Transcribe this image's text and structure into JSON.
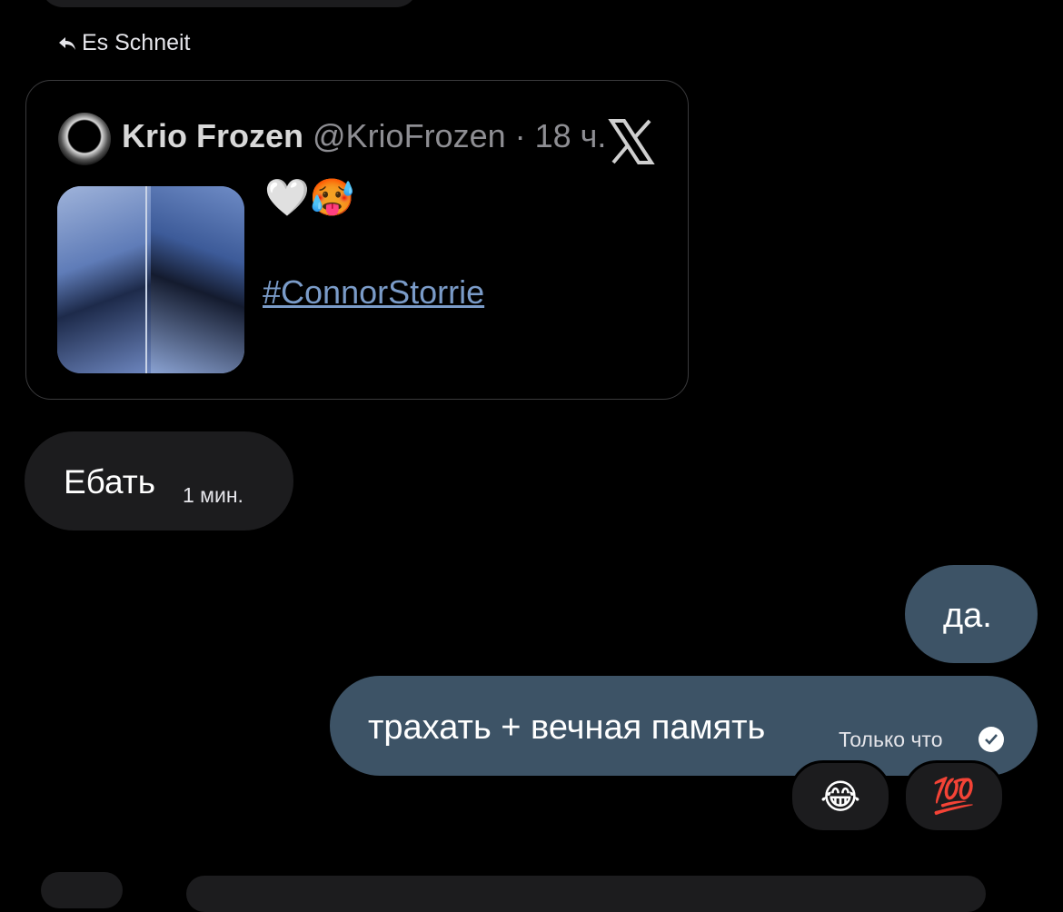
{
  "reply": {
    "label": "Es Schneit"
  },
  "tweet": {
    "name": "Krio Frozen",
    "handle_time": "@KrioFrozen · 18 ч.",
    "emojis": "🤍🥵",
    "hashtag": "#ConnorStorrie"
  },
  "incoming": {
    "text": "Ебать",
    "time": "1 мин."
  },
  "outgoing": [
    {
      "text": "да."
    },
    {
      "text": "трахать + вечная память",
      "time": "Только что"
    }
  ],
  "reactions": [
    "😂",
    "💯"
  ],
  "colors": {
    "out_bubble": "#3d5366",
    "in_bubble": "#1c1c1e",
    "link": "#7a9bc8"
  }
}
